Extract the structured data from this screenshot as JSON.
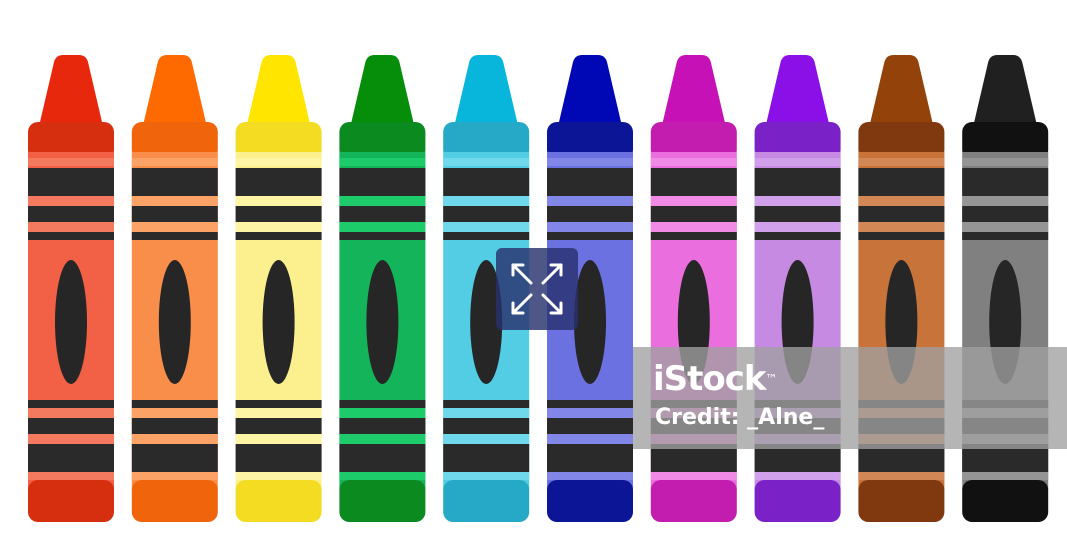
{
  "image": {
    "subject": "crayons",
    "crayon_colors": [
      {
        "name": "red",
        "tip": "#e8280c",
        "band": "#d62f10",
        "body": "#f26146",
        "stripe": "#f47a5f"
      },
      {
        "name": "orange",
        "tip": "#ff6a00",
        "band": "#f0650c",
        "body": "#f98e4a",
        "stripe": "#fba267"
      },
      {
        "name": "yellow",
        "tip": "#ffe500",
        "band": "#f3dc22",
        "body": "#fcf08e",
        "stripe": "#fdf4a6"
      },
      {
        "name": "green",
        "tip": "#068d0a",
        "band": "#0b8a20",
        "body": "#14b55a",
        "stripe": "#1ecb6a"
      },
      {
        "name": "cyan",
        "tip": "#08b6dc",
        "band": "#26a9c6",
        "body": "#52cde3",
        "stripe": "#6fd8ea"
      },
      {
        "name": "blue",
        "tip": "#0007b4",
        "band": "#0c1596",
        "body": "#6b71e1",
        "stripe": "#8286e6"
      },
      {
        "name": "magenta",
        "tip": "#c511b5",
        "band": "#c21dae",
        "body": "#ea6edd",
        "stripe": "#f08ae5"
      },
      {
        "name": "purple",
        "tip": "#8b10e8",
        "band": "#7a22c8",
        "body": "#c68ae3",
        "stripe": "#d1a0ea"
      },
      {
        "name": "brown",
        "tip": "#93420a",
        "band": "#80380e",
        "body": "#c8733a",
        "stripe": "#d28856"
      },
      {
        "name": "black",
        "tip": "#202020",
        "band": "#111111",
        "body": "#808080",
        "stripe": "#959595"
      }
    ],
    "stripe_color": "#2a2a2a",
    "oval_color": "#262626"
  },
  "overlay": {
    "expand_icon": "expand-arrows-icon"
  },
  "watermark": {
    "brand": "iStock",
    "trademark": "™",
    "credit": "Credit: _Alne_"
  }
}
